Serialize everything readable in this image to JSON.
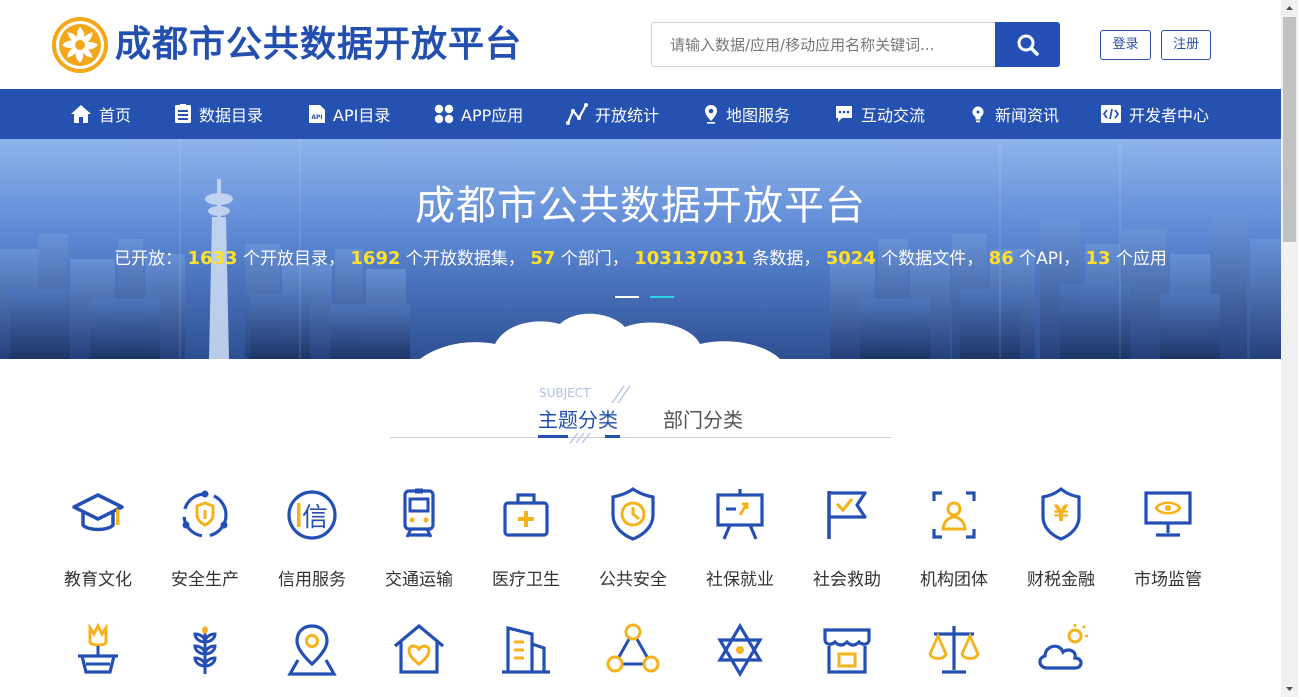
{
  "header": {
    "logo_text": "成都市公共数据开放平台",
    "search_placeholder": "请输入数据/应用/移动应用名称关键词...",
    "login_label": "登录",
    "register_label": "注册"
  },
  "nav": {
    "items": [
      {
        "label": "首页",
        "icon": "home-icon"
      },
      {
        "label": "数据目录",
        "icon": "list-icon"
      },
      {
        "label": "API目录",
        "icon": "api-file-icon"
      },
      {
        "label": "APP应用",
        "icon": "apps-icon"
      },
      {
        "label": "开放统计",
        "icon": "chart-line-icon"
      },
      {
        "label": "地图服务",
        "icon": "map-pin-icon"
      },
      {
        "label": "互动交流",
        "icon": "chat-icon"
      },
      {
        "label": "新闻资讯",
        "icon": "bulb-icon"
      },
      {
        "label": "开发者中心",
        "icon": "code-icon"
      }
    ]
  },
  "banner": {
    "title": "成都市公共数据开放平台",
    "stats_prefix": "已开放：",
    "stats": [
      {
        "value": "1633",
        "suffix": "个开放目录，"
      },
      {
        "value": "1692",
        "suffix": "个开放数据集，"
      },
      {
        "value": "57",
        "suffix": "个部门，"
      },
      {
        "value": "103137031",
        "suffix": "条数据，"
      },
      {
        "value": "5024",
        "suffix": "个数据文件，"
      },
      {
        "value": "86",
        "suffix": "个API，"
      },
      {
        "value": "13",
        "suffix": "个应用"
      }
    ]
  },
  "tabs": {
    "subject_en": "SUBJECT",
    "theme": "主题分类",
    "department": "部门分类"
  },
  "categories": {
    "row1": [
      {
        "label": "教育文化",
        "icon": "graduation-cap-icon"
      },
      {
        "label": "安全生产",
        "icon": "safety-shield-icon"
      },
      {
        "label": "信用服务",
        "icon": "credit-icon"
      },
      {
        "label": "交通运输",
        "icon": "train-icon"
      },
      {
        "label": "医疗卫生",
        "icon": "medical-kit-icon"
      },
      {
        "label": "公共安全",
        "icon": "public-security-icon"
      },
      {
        "label": "社保就业",
        "icon": "presentation-board-icon"
      },
      {
        "label": "社会救助",
        "icon": "flag-icon"
      },
      {
        "label": "机构团体",
        "icon": "id-card-icon"
      },
      {
        "label": "财税金融",
        "icon": "yen-shield-icon"
      },
      {
        "label": "市场监管",
        "icon": "monitor-eye-icon"
      }
    ],
    "row2_icons": [
      "flower-pot-icon",
      "wheat-icon",
      "location-icon",
      "house-heart-icon",
      "building-icon",
      "triangle-nodes-icon",
      "star-of-david-icon",
      "shop-icon",
      "scales-icon",
      "weather-icon"
    ]
  },
  "colors": {
    "brand_blue": "#2552b0",
    "accent_yellow": "#f5b21a",
    "highlight_yellow": "#ffe02a"
  }
}
